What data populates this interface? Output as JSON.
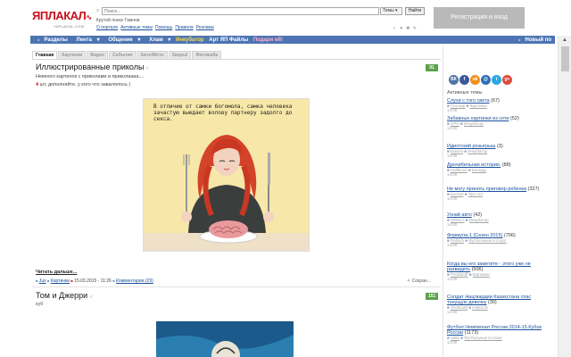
{
  "header": {
    "logo_text": "ЯПЛАКАЛ",
    "logo_subtext": "YAPLAKAL.COM",
    "search_placeholder": "Поиск...",
    "search_scope": "Темы",
    "search_button": "Найти",
    "search_hint": "Крутой поиск Гамнов",
    "top_links": [
      "О портале",
      "Активные темы",
      "Помощь",
      "Правила",
      "Реклама"
    ],
    "icons": "✓ ✦ ❃ ✎",
    "register_label": "Регистрация и вход"
  },
  "nav": {
    "items": [
      {
        "label": "Разделы",
        "style": ""
      },
      {
        "label": "Лента",
        "style": ""
      },
      {
        "label": "Общение",
        "style": ""
      },
      {
        "label": "Хлам",
        "style": ""
      },
      {
        "label": "Инкубатор",
        "style": "yellow"
      },
      {
        "label": "Арт ЯП Файлы",
        "style": ""
      },
      {
        "label": "Подари ей!",
        "style": "pink"
      }
    ],
    "new_posts": "Новый по"
  },
  "tabs": [
    "Главная",
    "Картинки",
    "Видео",
    "События",
    "Авто/Мото",
    "Зверьё",
    "Фотожаба"
  ],
  "post1": {
    "title": "Иллюстрированные приколы",
    "score": "91",
    "desc": "Немного картинок с приколами и приколаааа....",
    "desc2_prefix": "4",
    "desc2_rest": " шт, дополняйте, у кого что завалялось )",
    "image_caption": "В отличие от самки богомола, самка человека зачастую выедает волову партнеру задолго до секса.",
    "read_more": "Читать дальше...",
    "author": "Jus",
    "section": "Картинки",
    "date": "15.03.2015 - 11:26",
    "comments": "Комментарии (29)",
    "save": "Сохран..."
  },
  "post2": {
    "title": "Том и Джерри",
    "score": "151",
    "desc": "куб"
  },
  "sidebar": {
    "title": "Активные темы",
    "social": [
      {
        "label": "ВК",
        "color": "#4c75a3"
      },
      {
        "label": "f",
        "color": "#3b5998"
      },
      {
        "label": "ok",
        "color": "#f28d1a"
      },
      {
        "label": "@",
        "color": "#2e6fb7"
      },
      {
        "label": "t",
        "color": "#2ca7e0"
      },
      {
        "label": "g+",
        "color": "#dd4b39"
      }
    ],
    "topics": [
      {
        "title": "Слухи с того света",
        "count": "(67)",
        "user": "Грогнар",
        "section": "Картинки",
        "time": "14:00"
      },
      {
        "title": "Забавные картинки из сети",
        "count": "(52)",
        "user": "GPH",
        "section": "Инкубатор",
        "time": "14:00"
      },
      {
        "title": "Идиотский розыгрыш",
        "count": "(3)",
        "user": "katarra",
        "section": "Инкубатор",
        "time": "14:00"
      },
      {
        "title": "Дрочибельная история.",
        "count": "(88)",
        "user": "Hallblood",
        "section": "Беседы",
        "time": "14:00"
      },
      {
        "title": "Не могу принять приговор ребенка",
        "count": "(327)",
        "user": "kaz033",
        "section": "Про это",
        "time": "14:00"
      },
      {
        "title": "Узнай авто",
        "count": "(42)",
        "user": "SMOLA",
        "section": "Инкубатор",
        "time": "14:00"
      },
      {
        "title": "Формула-1 (Сезон 2015)",
        "count": "(706)",
        "user": "Ralloch",
        "section": "Футбольные и спорт",
        "time": "14:00"
      },
      {
        "title": "Когда вы его заметите - этого уже не развидеть",
        "count": "(506)",
        "user": "Pondaroff",
        "section": "Картинки",
        "time": "14:00"
      },
      {
        "title": "Солдат Нацгвардии Казахстана спас тонущую девочку",
        "count": "(30)",
        "user": "Shoktodd",
        "section": "Новости",
        "time": "14:00"
      },
      {
        "title": "Футбол.Чемпионат России 2014-15.Кубок России",
        "count": "(1173)",
        "user": "1991",
        "section": "Футбольные и спорт",
        "time": "14:00"
      }
    ]
  }
}
